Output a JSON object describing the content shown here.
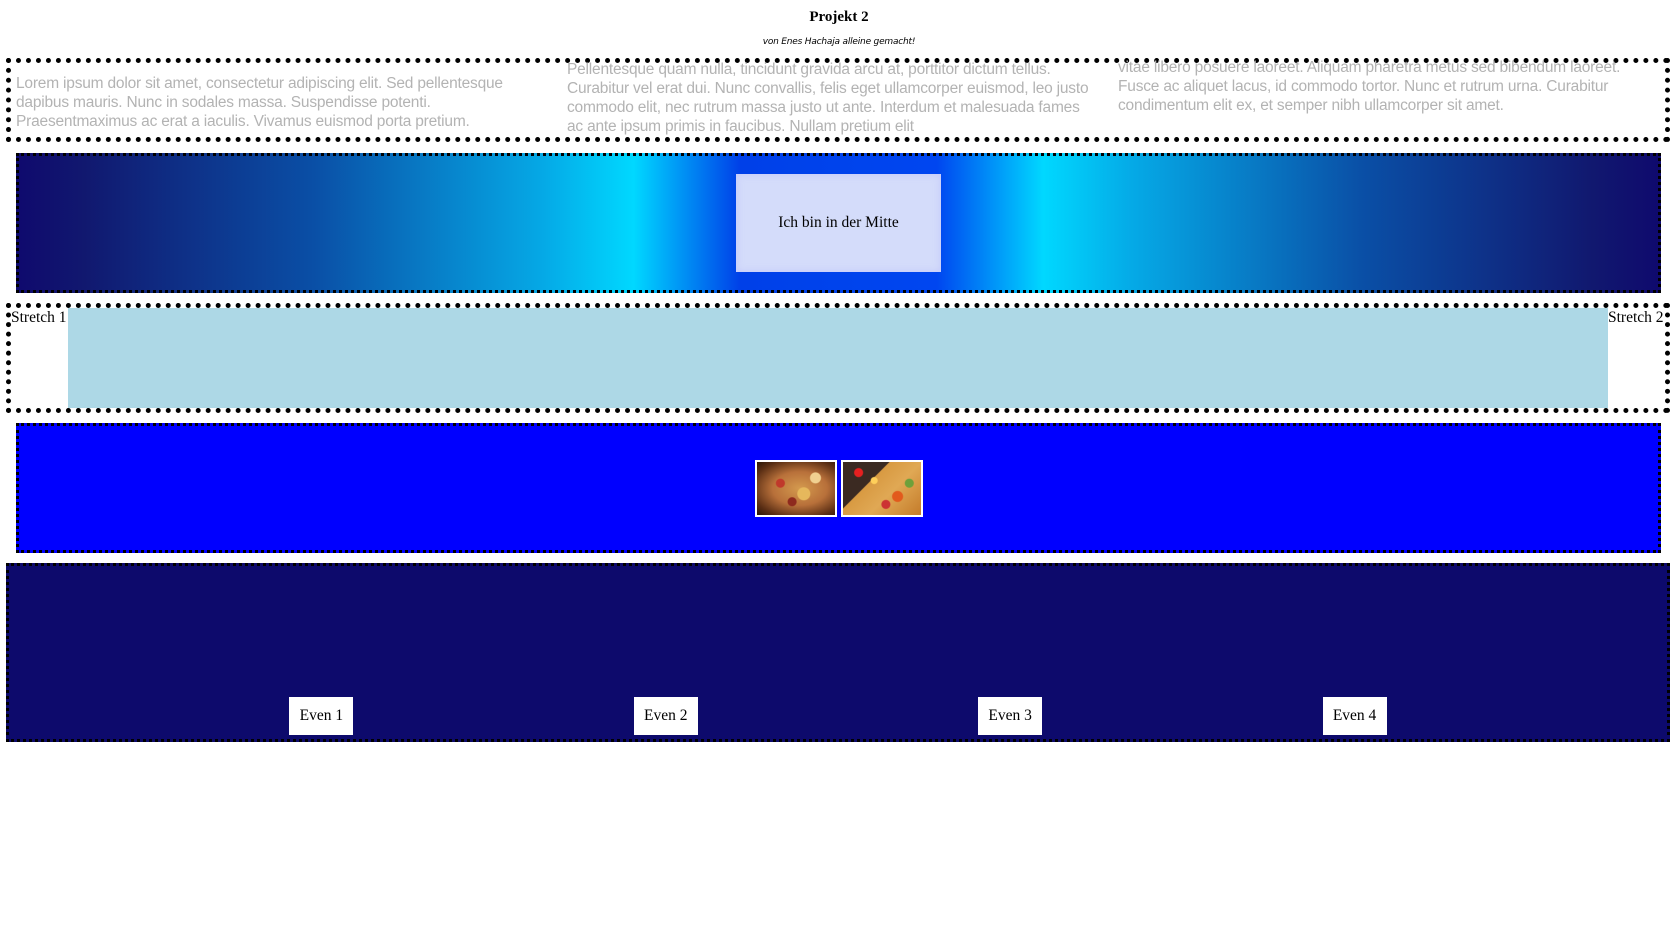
{
  "header": {
    "title": "Projekt 2",
    "subtitle": "von Enes Hachaja alleine gemacht!"
  },
  "text_columns": [
    "Lorem ipsum dolor sit amet, consectetur adipiscing elit. Sed pellentesque dapibus mauris. Nunc in sodales massa. Suspendisse potenti. Praesentmaximus ac erat a iaculis. Vivamus euismod porta pretium.",
    "Pellentesque quam nulla, tincidunt gravida arcu at, porttitor dictum tellus. Curabitur vel erat dui. Nunc convallis, felis eget ullamcorper euismod, leo justo commodo elit, nec rutrum massa justo ut ante. Interdum et malesuada fames ac ante ipsum primis in faucibus. Nullam pretium elit",
    "vitae libero posuere laoreet. Aliquam pharetra metus sed bibendum laoreet. Fusce ac aliquet lacus, id commodo tortor. Nunc et rutrum urna. Curabitur condimentum elit ex, et semper nibh ullamcorper sit amet."
  ],
  "center_box": {
    "label": "Ich bin in der Mitte"
  },
  "stretch": {
    "left_label": "Stretch 1",
    "right_label": "Stretch 2",
    "fill_color": "#add8e6"
  },
  "images_row": {
    "background": "#0000ff",
    "images": [
      {
        "icon": "pizza-photo-1"
      },
      {
        "icon": "pizza-photo-2"
      }
    ]
  },
  "even_row": {
    "background": "#0d0a6c",
    "items": [
      "Even 1",
      "Even 2",
      "Even 3",
      "Even 4"
    ]
  }
}
